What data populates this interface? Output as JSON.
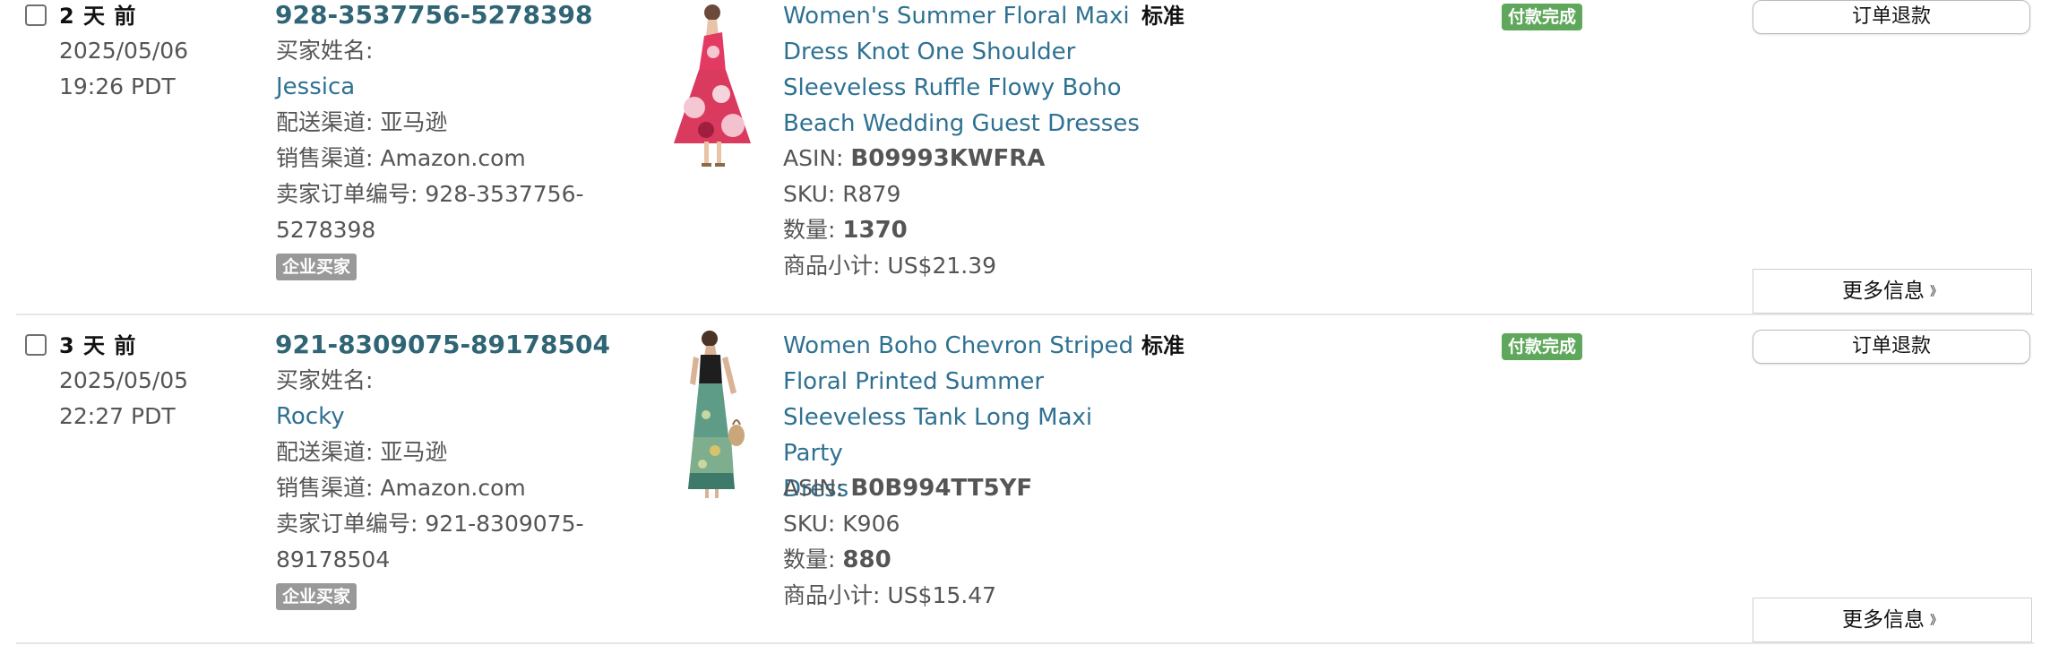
{
  "orders": [
    {
      "age": "2 天 前",
      "date": "2025/05/06",
      "time": "19:26 PDT",
      "order_id": "928-3537756-5278398",
      "buyer_label": "买家姓名:",
      "buyer_name": "Jessica",
      "fulfillment_label": "配送渠道:",
      "fulfillment_value": "亚马逊",
      "sales_channel_label": "销售渠道:",
      "sales_channel_value": "Amazon.com",
      "seller_order_label": "卖家订单编号:",
      "seller_order_line1": "928-3537756-",
      "seller_order_line2": "5278398",
      "business_badge": "企业买家",
      "product_title_lines": [
        "Women's Summer Floral Maxi",
        "Dress Knot One Shoulder",
        "Sleeveless Ruffle Flowy Boho",
        "Beach Wedding Guest Dresses"
      ],
      "asin_label": "ASIN:",
      "asin": "B09993KWFRA",
      "sku_label": "SKU:",
      "sku": "R879",
      "qty_label": "数量:",
      "qty": "1370",
      "subtotal_label": "商品小计:",
      "subtotal": "US$21.39",
      "shipping_type": "标准",
      "payment_status": "付款完成",
      "refund_button": "订单退款",
      "more_info_button": "更多信息",
      "more_icon": "double-chevron-down-icon",
      "image": "red-floral-dress-photo"
    },
    {
      "age": "3 天 前",
      "date": "2025/05/05",
      "time": "22:27 PDT",
      "order_id": "921-8309075-89178504",
      "buyer_label": "买家姓名:",
      "buyer_name": "Rocky",
      "fulfillment_label": "配送渠道:",
      "fulfillment_value": "亚马逊",
      "sales_channel_label": "销售渠道:",
      "sales_channel_value": "Amazon.com",
      "seller_order_label": "卖家订单编号:",
      "seller_order_line1": "921-8309075-",
      "seller_order_line2": "89178504",
      "business_badge": "企业买家",
      "product_title_lines": [
        "Women Boho Chevron Striped",
        "Floral Printed Summer",
        "Sleeveless Tank Long Maxi Party",
        "Dress"
      ],
      "asin_label": "ASIN:",
      "asin": "B0B994TT5YF",
      "sku_label": "SKU:",
      "sku": "K906",
      "qty_label": "数量:",
      "qty": "880",
      "subtotal_label": "商品小计:",
      "subtotal": "US$15.47",
      "shipping_type": "标准",
      "payment_status": "付款完成",
      "refund_button": "订单退款",
      "more_info_button": "更多信息",
      "more_icon": "double-chevron-down-icon",
      "image": "green-black-maxi-dress-photo"
    }
  ],
  "colors": {
    "link": "#2f7192",
    "order_id": "#2f6574",
    "paid_badge": "#5fa85b",
    "business_badge": "#999999"
  }
}
